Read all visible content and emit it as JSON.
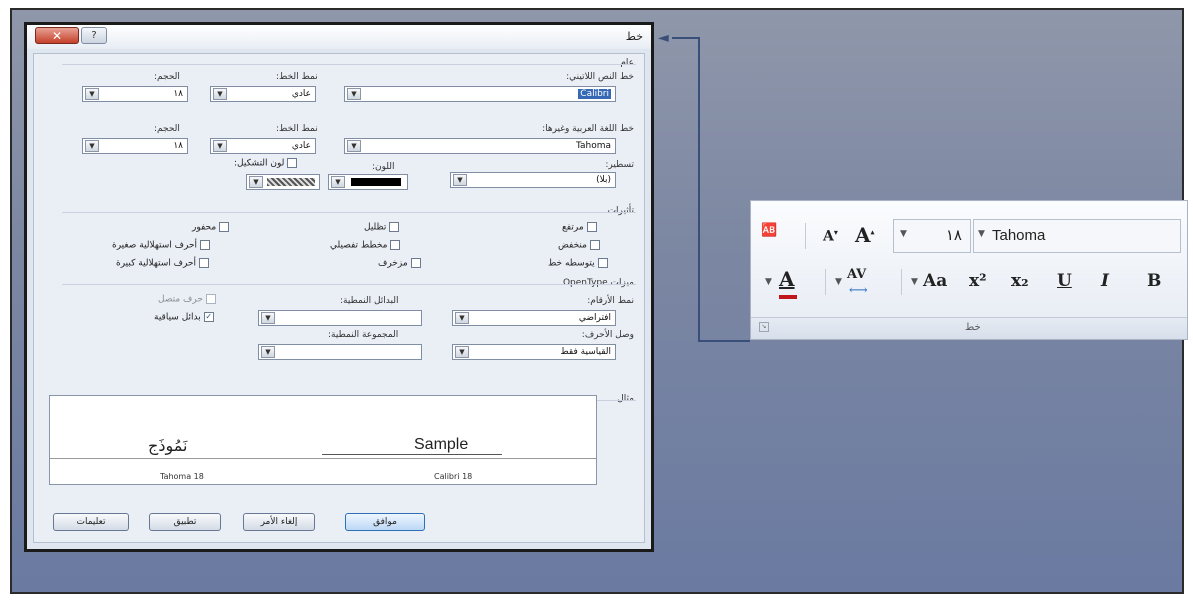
{
  "dialog": {
    "title": "خط",
    "close_label": "✕",
    "help_label": "?",
    "general": {
      "heading": "عام",
      "latin_font_label": "خط النص اللاتيني:",
      "latin_font_value": "Calibri",
      "style_label": "نمط الخط:",
      "latin_style_value": "عادي",
      "size_label": "الحجم:",
      "latin_size_value": "١٨",
      "complex_font_label": "خط اللغة العربية وغيرها:",
      "complex_font_value": "Tahoma",
      "complex_style_value": "عادي",
      "complex_size_value": "١٨",
      "underline_label": "تسطير:",
      "underline_value": "(بلا)",
      "color_label": "اللون:",
      "diacritic_color_label": "لون التشكيل:"
    },
    "effects": {
      "heading": "تأثيرات",
      "items": [
        {
          "label": "مرتفع",
          "checked": false
        },
        {
          "label": "تظليل",
          "checked": false
        },
        {
          "label": "محفور",
          "checked": false
        },
        {
          "label": "منخفض",
          "checked": false
        },
        {
          "label": "مخطط تفصيلي",
          "checked": false
        },
        {
          "label": "أحرف استهلالية صغيرة",
          "checked": false
        },
        {
          "label": "يتوسطه خط",
          "checked": false
        },
        {
          "label": "مزخرف",
          "checked": false
        },
        {
          "label": "أحرف استهلالية كبيرة",
          "checked": false
        }
      ]
    },
    "opentype": {
      "heading": "ميزات OpenType",
      "number_style_label": "نمط الأرقام:",
      "number_style_value": "افتراضي",
      "stylistic_alt_label": "البدائل النمطية:",
      "stylistic_alt_value": "",
      "contextual_label": "حرف متصل",
      "contextual_checked": false,
      "swash_label": "بدائل سياقية",
      "swash_checked": true,
      "ligatures_label": "وصل الأحرف:",
      "ligatures_value": "القياسية فقط",
      "stylistic_set_label": "المجموعة النمطية:",
      "stylistic_set_value": ""
    },
    "preview": {
      "heading": "مثال",
      "latin_sample": "Sample",
      "arabic_sample": "نَمُوذَج",
      "latin_caption": "Calibri 18",
      "arabic_caption": "Tahoma 18"
    },
    "buttons": {
      "ok": "موافق",
      "cancel": "إلغاء الأمر",
      "apply": "تطبيق",
      "help": "تعليمات"
    }
  },
  "ribbon": {
    "group_label": "خط",
    "font_name": "Tahoma",
    "font_size": "١٨",
    "grow_label": "A",
    "shrink_label": "A",
    "case_label": "Aa",
    "superscript_label": "x²",
    "subscript_label": "x₂",
    "underline_label": "U",
    "italic_label": "I",
    "bold_label": "B",
    "spacing_label": "AV",
    "font_color_label": "A",
    "font_color": "#c0161c"
  }
}
